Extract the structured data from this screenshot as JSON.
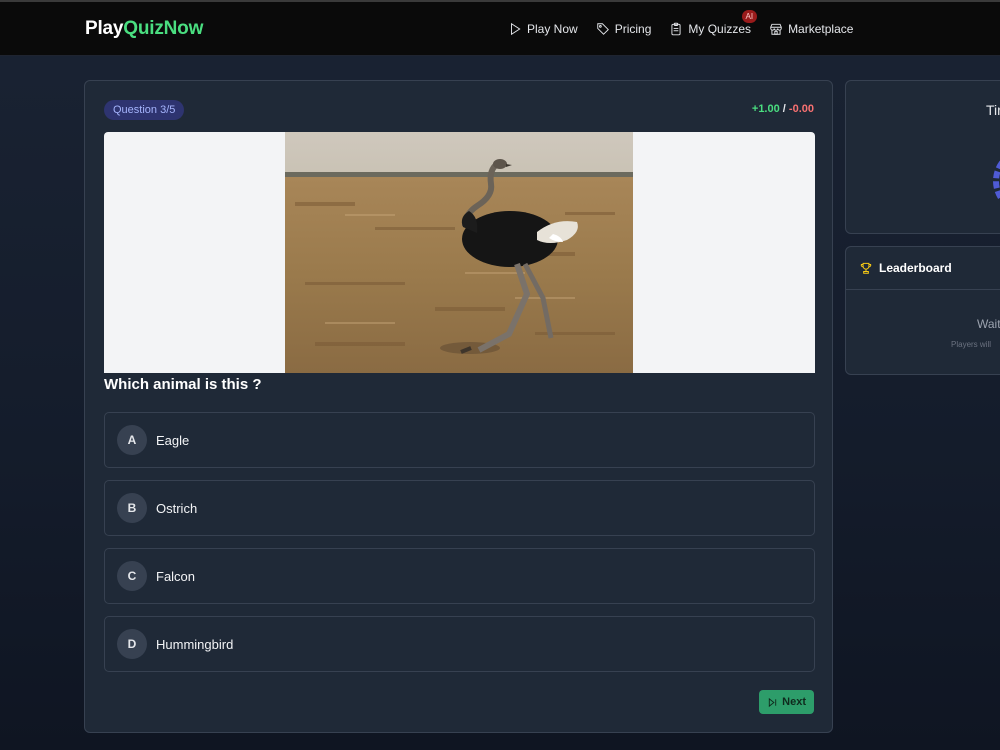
{
  "brand": {
    "part1": "Play",
    "part2": "QuizNow",
    "accent_color": "#4ade80"
  },
  "nav": {
    "items": [
      {
        "label": "Play Now",
        "icon": "play-icon"
      },
      {
        "label": "Pricing",
        "icon": "tag-icon"
      },
      {
        "label": "My Quizzes",
        "icon": "clipboard-icon",
        "badge": "AI"
      },
      {
        "label": "Marketplace",
        "icon": "store-icon"
      }
    ]
  },
  "quiz": {
    "question_badge": "Question 3/5",
    "score_plus": "+1.00",
    "score_sep": "/",
    "score_minus": "-0.00",
    "image_icon": "ostrich-photo",
    "question": "Which animal is this ?",
    "options": [
      {
        "letter": "A",
        "text": "Eagle"
      },
      {
        "letter": "B",
        "text": "Ostrich"
      },
      {
        "letter": "C",
        "text": "Falcon"
      },
      {
        "letter": "D",
        "text": "Hummingbird"
      }
    ],
    "next_label": "Next"
  },
  "timer": {
    "label": "Tir"
  },
  "leaderboard": {
    "title": "Leaderboard",
    "waiting": "Wait",
    "subtext": "Players will"
  },
  "colors": {
    "correct": "#4ade80",
    "wrong": "#f87171",
    "badge_bg": "#2e3470",
    "next_button": "#2d9d6a",
    "trophy": "#facc15"
  }
}
